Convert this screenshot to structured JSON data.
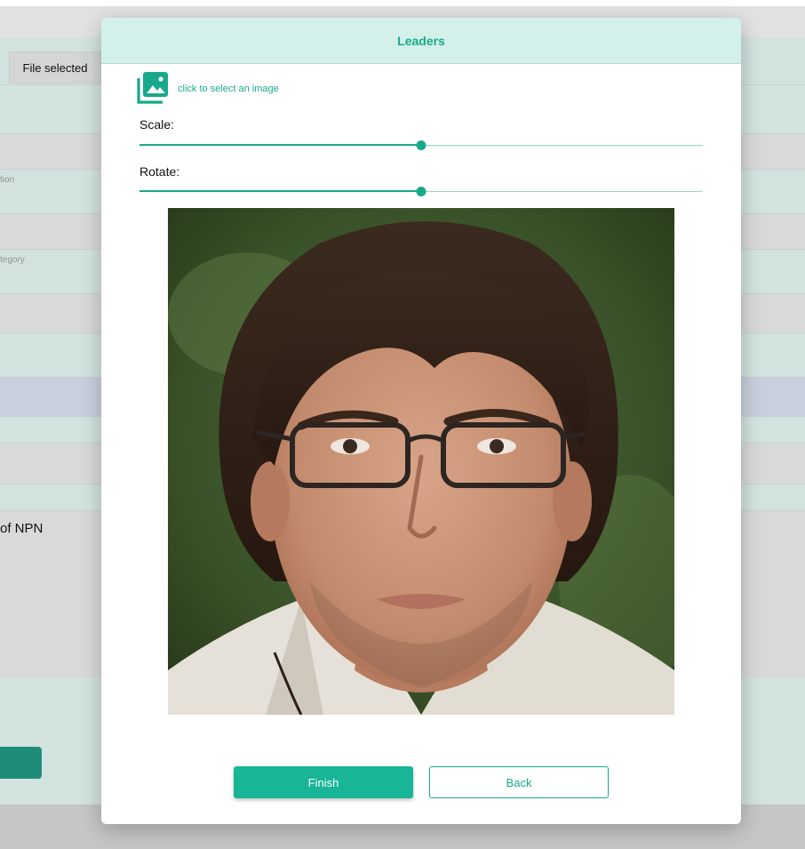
{
  "background": {
    "file_button_label": "File selected",
    "field_hint_1": "tion",
    "field_hint_2": "tegory",
    "text_fragment": "of NPN"
  },
  "modal": {
    "title": "Leaders",
    "upload": {
      "icon": "image-gallery-icon",
      "label": "click to select an image"
    },
    "scale": {
      "label": "Scale:",
      "value": 0.5
    },
    "rotate": {
      "label": "Rotate:",
      "value": 0.5
    },
    "photo": {
      "alt": "portrait"
    },
    "buttons": {
      "finish": "Finish",
      "back": "Back"
    }
  },
  "colors": {
    "accent": "#18a98d",
    "header_bg": "#d3f0ea",
    "button_bg": "#18b596"
  }
}
